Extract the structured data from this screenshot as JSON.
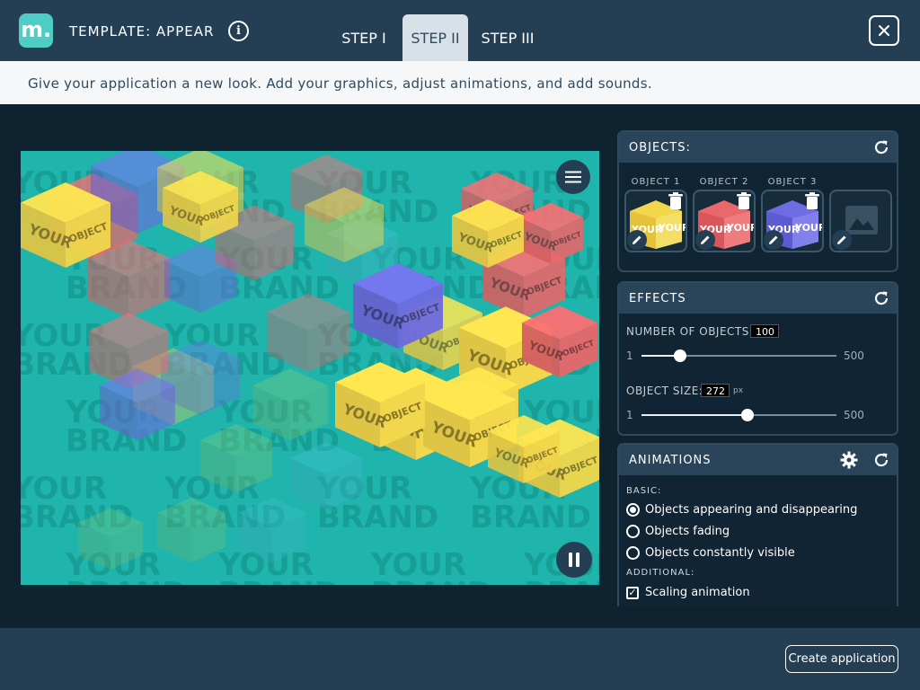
{
  "header": {
    "logo_letter": "m.",
    "title": "TEMPLATE: APPEAR",
    "tabs": [
      {
        "label": "STEP I",
        "active": false
      },
      {
        "label": "STEP II",
        "active": true
      },
      {
        "label": "STEP III",
        "active": false
      }
    ]
  },
  "subtitle": "Give your application a new look. Add your graphics, adjust animations, and add sounds.",
  "stage": {
    "background": "#1fb4ac",
    "watermark_lines": [
      "YOUR",
      "BRAND"
    ],
    "cube_label_lines": [
      "YOUR",
      "OBJECT"
    ],
    "cube_colors": [
      "#f2d64b",
      "#e8686b",
      "#6e6ce0",
      "#3fb8c9",
      "#7cc36e"
    ]
  },
  "objects": {
    "heading": "OBJECTS:",
    "items": [
      {
        "label": "OBJECT 1",
        "color": "#f2d64b"
      },
      {
        "label": "OBJECT 2",
        "color": "#e8686b"
      },
      {
        "label": "OBJECT 3",
        "color": "#6e6ce0"
      }
    ],
    "placeholder_icon": "image-icon"
  },
  "effects": {
    "heading": "EFFECTS",
    "count": {
      "label": "NUMBER OF OBJECTS:",
      "value": "100",
      "min": "1",
      "max": "500",
      "level": 0.198
    },
    "size": {
      "label": "OBJECT SIZE:",
      "value": "272",
      "unit": "px",
      "min": "1",
      "max": "500",
      "level": 0.543
    }
  },
  "animations": {
    "heading": "ANIMATIONS",
    "basic_label": "BASIC:",
    "basic_options": [
      {
        "label": "Objects appearing and disappearing",
        "selected": true
      },
      {
        "label": "Objects fading",
        "selected": false
      },
      {
        "label": "Objects constantly visible",
        "selected": false
      }
    ],
    "additional_label": "ADDITIONAL:",
    "additional_options": [
      {
        "label": "Scaling animation",
        "checked": true
      }
    ]
  },
  "footer": {
    "create_label": "Create application"
  }
}
